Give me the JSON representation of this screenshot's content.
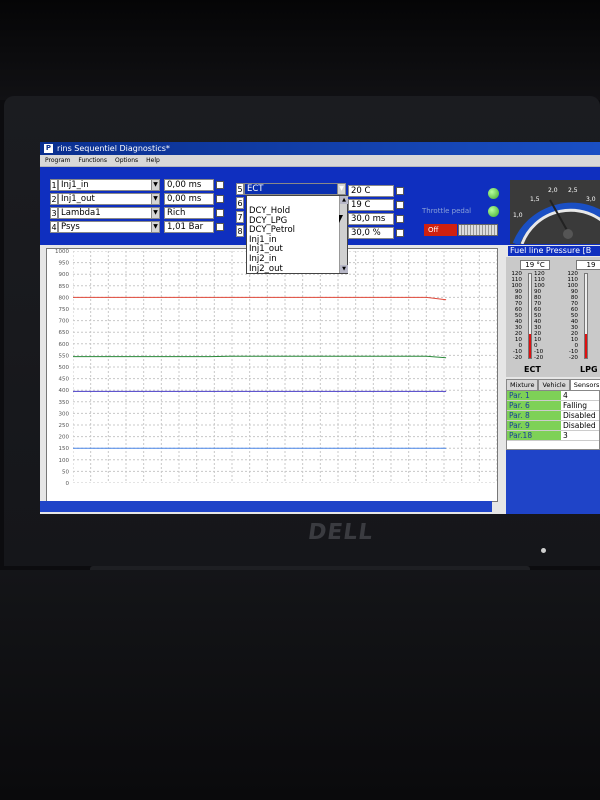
{
  "window": {
    "title": "rins Sequentiel Diagnostics*",
    "app_icon": "P"
  },
  "menu": [
    "Program",
    "Functions",
    "Options",
    "Help"
  ],
  "slots_left": [
    {
      "num": "1",
      "name": "Inj1_in",
      "value": "0,00 ms"
    },
    {
      "num": "2",
      "name": "Inj1_out",
      "value": "0,00 ms"
    },
    {
      "num": "3",
      "name": "Lambda1",
      "value": "Rich"
    },
    {
      "num": "4",
      "name": "Psys",
      "value": "1,01 Bar"
    }
  ],
  "slots_right": [
    {
      "num": "5",
      "name": "ECT",
      "value": "20 C"
    },
    {
      "num": "6",
      "name": "",
      "value": "19 C"
    },
    {
      "num": "7",
      "name": "",
      "value": "30,0 ms"
    },
    {
      "num": "8",
      "name": "",
      "value": "30,0 %"
    }
  ],
  "dropdown_options": [
    "DCY_Hold",
    "DCY_LPG",
    "DCY_Petrol",
    "Inj1_in",
    "Inj1_out",
    "Inj2_in",
    "Inj2_out"
  ],
  "indicators": {
    "throttle_label": "Throttle pedal",
    "off_label": "Off"
  },
  "gauge": {
    "ticks": [
      "1,0",
      "1,5",
      "2,0",
      "2,5",
      "3,0"
    ],
    "label": "Fuel line Pressure [B"
  },
  "chart_data": {
    "type": "line",
    "y_ticks": [
      1000,
      950,
      900,
      850,
      800,
      750,
      700,
      650,
      600,
      550,
      500,
      450,
      400,
      350,
      300,
      250,
      200,
      150,
      100,
      50,
      0
    ],
    "ylim": [
      0,
      1000
    ],
    "grid": true,
    "series": [
      {
        "color": "#e0483a",
        "y": [
          800,
          800,
          800,
          800,
          800,
          800,
          800,
          800,
          800,
          800,
          800,
          800,
          800,
          800,
          800,
          800,
          800,
          800,
          800,
          790
        ]
      },
      {
        "color": "#2a8a3a",
        "y": [
          545,
          545,
          545,
          545,
          545,
          545,
          545,
          545,
          546,
          546,
          546,
          546,
          546,
          546,
          546,
          546,
          546,
          546,
          546,
          540
        ]
      },
      {
        "color": "#4a3ec8",
        "y": [
          395,
          395,
          395,
          395,
          395,
          395,
          395,
          395,
          395,
          395,
          395,
          395,
          395,
          395,
          395,
          395,
          395,
          395,
          395,
          395
        ]
      },
      {
        "color": "#4a86e8",
        "y": [
          150,
          150,
          150,
          150,
          150,
          150,
          150,
          150,
          150,
          150,
          150,
          150,
          150,
          150,
          150,
          150,
          150,
          150,
          150,
          150
        ]
      }
    ]
  },
  "thermometers": [
    {
      "name": "ECT",
      "reading": "19 °C",
      "level_fraction": 0.29,
      "scale": [
        "120",
        "110",
        "100",
        "90",
        "80",
        "70",
        "60",
        "50",
        "40",
        "30",
        "20",
        "10",
        "0",
        "-10",
        "-20"
      ]
    },
    {
      "name": "LPG",
      "reading": "19",
      "level_fraction": 0.29,
      "scale": [
        "120",
        "110",
        "100",
        "90",
        "80",
        "70",
        "60",
        "50",
        "40",
        "30",
        "20",
        "10",
        "0",
        "-10",
        "-20"
      ]
    }
  ],
  "tabs": [
    "Mixture",
    "Vehicle",
    "Sensors"
  ],
  "params": [
    {
      "key": "Par. 1",
      "value": "4"
    },
    {
      "key": "Par. 6",
      "value": "Falling"
    },
    {
      "key": "Par. 8",
      "value": "Disabled"
    },
    {
      "key": "Par. 9",
      "value": "Disabled"
    },
    {
      "key": "Par.18",
      "value": "3"
    }
  ],
  "bezel": {
    "brand": "DELL"
  }
}
